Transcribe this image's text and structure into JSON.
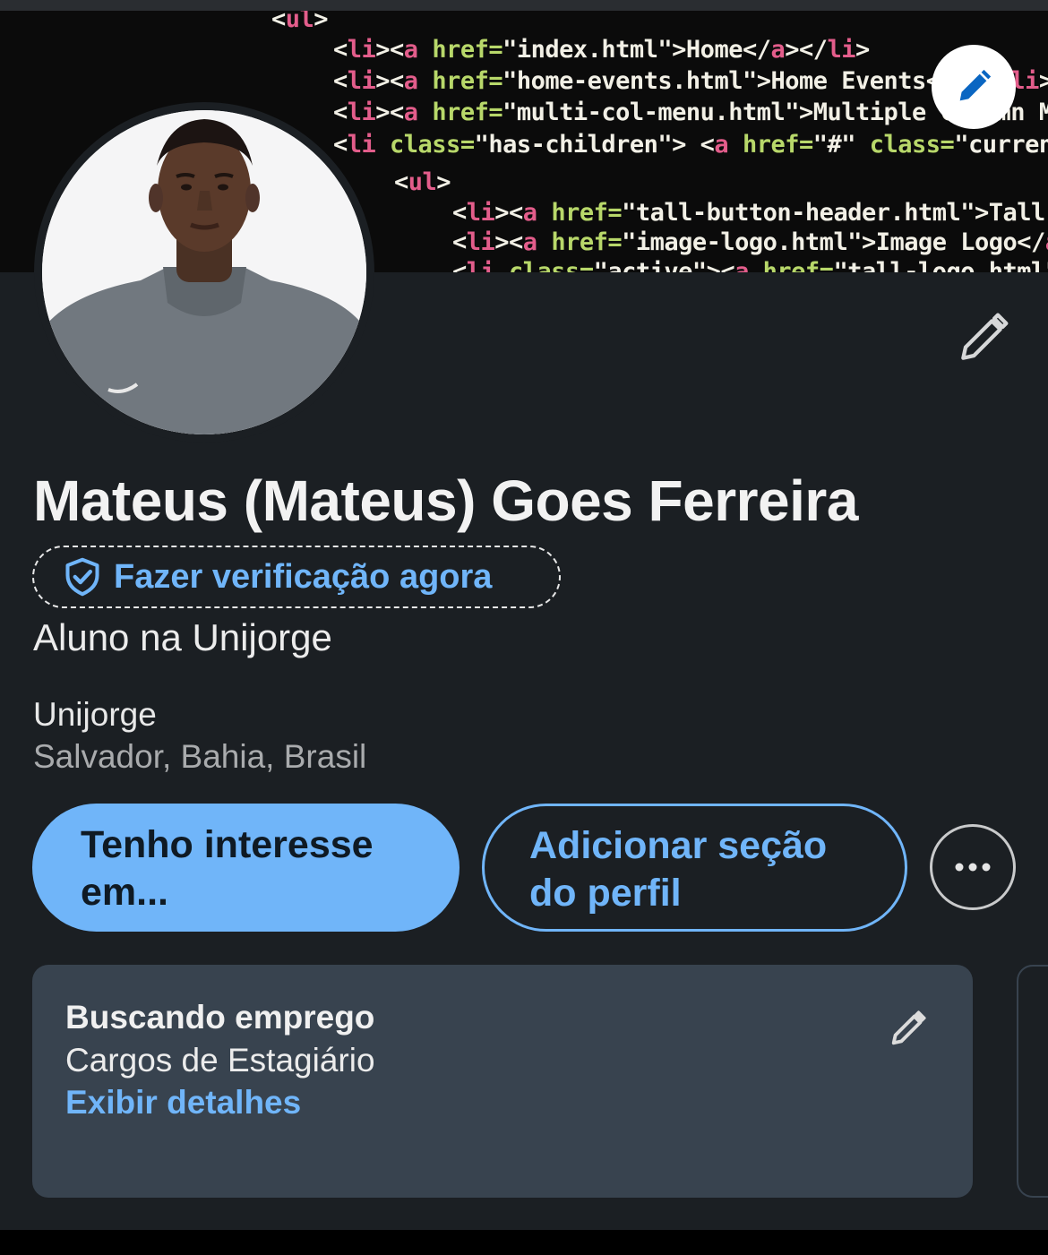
{
  "banner": {
    "code_lines": [
      [
        {
          "t": "<",
          "c": "str"
        },
        {
          "t": "ul",
          "c": "tag"
        },
        {
          "t": ">",
          "c": "str"
        }
      ],
      [
        {
          "t": "<",
          "c": "str"
        },
        {
          "t": "li",
          "c": "tag"
        },
        {
          "t": "><",
          "c": "str"
        },
        {
          "t": "a",
          "c": "tag"
        },
        {
          "t": " href=",
          "c": "attr"
        },
        {
          "t": "\"index.html\">Home</",
          "c": "str"
        },
        {
          "t": "a",
          "c": "tag"
        },
        {
          "t": "></",
          "c": "str"
        },
        {
          "t": "li",
          "c": "tag"
        },
        {
          "t": ">",
          "c": "str"
        }
      ],
      [
        {
          "t": "<",
          "c": "str"
        },
        {
          "t": "li",
          "c": "tag"
        },
        {
          "t": "><",
          "c": "str"
        },
        {
          "t": "a",
          "c": "tag"
        },
        {
          "t": " href=",
          "c": "attr"
        },
        {
          "t": "\"home-events.html\">Home Events</",
          "c": "str"
        },
        {
          "t": "a",
          "c": "tag"
        },
        {
          "t": "></",
          "c": "str"
        },
        {
          "t": "li",
          "c": "tag"
        },
        {
          "t": ">",
          "c": "str"
        }
      ],
      [
        {
          "t": "<",
          "c": "str"
        },
        {
          "t": "li",
          "c": "tag"
        },
        {
          "t": "><",
          "c": "str"
        },
        {
          "t": "a",
          "c": "tag"
        },
        {
          "t": " href=",
          "c": "attr"
        },
        {
          "t": "\"multi-col-menu.html\">Multiple Column Menu",
          "c": "str"
        }
      ],
      [
        {
          "t": "<",
          "c": "str"
        },
        {
          "t": "li",
          "c": "tag"
        },
        {
          "t": " class=",
          "c": "attr"
        },
        {
          "t": "\"has-children\"> <",
          "c": "str"
        },
        {
          "t": "a",
          "c": "tag"
        },
        {
          "t": " href=",
          "c": "attr"
        },
        {
          "t": "\"#\" ",
          "c": "str"
        },
        {
          "t": "class=",
          "c": "attr"
        },
        {
          "t": "\"current\"",
          "c": "str"
        }
      ],
      [
        {
          "t": "<",
          "c": "str"
        },
        {
          "t": "ul",
          "c": "tag"
        },
        {
          "t": ">",
          "c": "str"
        }
      ],
      [
        {
          "t": "<",
          "c": "str"
        },
        {
          "t": "li",
          "c": "tag"
        },
        {
          "t": "><",
          "c": "str"
        },
        {
          "t": "a",
          "c": "tag"
        },
        {
          "t": " href=",
          "c": "attr"
        },
        {
          "t": "\"tall-button-header.html\">Tall Button",
          "c": "str"
        }
      ],
      [
        {
          "t": "<",
          "c": "str"
        },
        {
          "t": "li",
          "c": "tag"
        },
        {
          "t": "><",
          "c": "str"
        },
        {
          "t": "a",
          "c": "tag"
        },
        {
          "t": " href=",
          "c": "attr"
        },
        {
          "t": "\"image-logo.html\">Image Logo</",
          "c": "str"
        },
        {
          "t": "a",
          "c": "tag"
        },
        {
          "t": "></",
          "c": "str"
        },
        {
          "t": "li",
          "c": "tag"
        },
        {
          "t": ">",
          "c": "str"
        }
      ],
      [
        {
          "t": "<",
          "c": "str"
        },
        {
          "t": "li",
          "c": "tag"
        },
        {
          "t": " class=",
          "c": "attr"
        },
        {
          "t": "\"active\"><",
          "c": "str"
        },
        {
          "t": "a",
          "c": "tag"
        },
        {
          "t": " href=",
          "c": "attr"
        },
        {
          "t": "\"tall-logo.html\">Tall",
          "c": "str"
        }
      ]
    ],
    "edit_icon": "pencil-icon"
  },
  "profile": {
    "name": "Mateus (Mateus) Goes Ferreira",
    "verify_label": "Fazer verificação agora",
    "verify_icon": "shield-check-icon",
    "headline": "Aluno na Unijorge",
    "company": "Unijorge",
    "location": "Salvador, Bahia, Brasil",
    "edit_icon": "pencil-icon"
  },
  "actions": {
    "primary_label": "Tenho interesse em...",
    "secondary_label": "Adicionar seção do perfil",
    "more_icon": "more-horizontal-icon"
  },
  "open_to_work": {
    "title": "Buscando emprego",
    "subtitle": "Cargos de Estagiário",
    "link": "Exibir detalhes",
    "edit_icon": "pencil-icon"
  },
  "colors": {
    "background": "#1b1f23",
    "accent": "#70b5f9",
    "card": "#38434f"
  }
}
